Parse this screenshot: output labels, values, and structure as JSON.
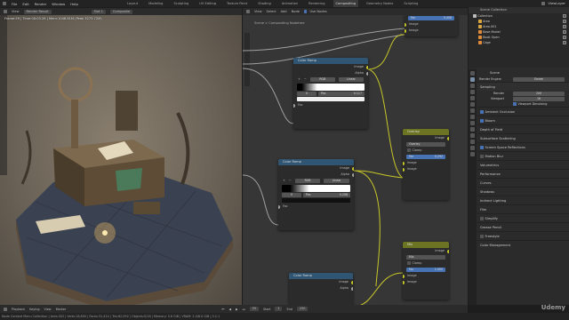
{
  "topbar": {
    "menus": [
      "File",
      "Edit",
      "Render",
      "Window",
      "Help"
    ],
    "workspaces": [
      "Layout",
      "Modeling",
      "Sculpting",
      "UV Editing",
      "Texture Paint",
      "Shading",
      "Animation",
      "Rendering",
      "Compositing",
      "Geometry Nodes",
      "Scripting"
    ],
    "active_workspace": "Compositing",
    "view_layer": "ViewLayer"
  },
  "viewport_header": {
    "items": [
      "View",
      "Render Result",
      "Slot 1",
      "Composite"
    ]
  },
  "viewport": {
    "info": "Frame:59 | Time:00:03.26 | Mem:1048.81M (Peak 3273.72M)"
  },
  "node_header": {
    "items": [
      "View",
      "Select",
      "Add",
      "Node",
      "Use Nodes"
    ],
    "blend_mode": "Multiply"
  },
  "node_breadcrumb": "Scene  >  Compositing Nodetree",
  "nodes": {
    "ramp1": {
      "title": "Color Ramp",
      "image": "Image",
      "alpha": "Alpha",
      "mode": "RGB",
      "interp": "Linear",
      "stop": "0",
      "pos_label": "Pos",
      "pos": "0.117",
      "fac": "Fac"
    },
    "ramp2": {
      "title": "Color Ramp",
      "image": "Image",
      "alpha": "Alpha",
      "mode": "RGB",
      "interp": "Linear",
      "stop": "0",
      "pos_label": "Pos",
      "pos": "0.208",
      "fac": "Fac"
    },
    "overlay": {
      "title": "Overlay",
      "image": "Image",
      "blend": "Overlay",
      "clamp": "Clamp",
      "fac_label": "Fac",
      "fac": "0.292",
      "in1": "Image",
      "in2": "Image"
    },
    "mix": {
      "title": "Mix",
      "image": "Image",
      "blend": "Mix",
      "clamp": "Clamp",
      "fac_label": "Fac",
      "fac": "1.000",
      "in1": "Image",
      "in2": "Image"
    },
    "top": {
      "fac_label": "Fac",
      "fac": "0.458",
      "in1": "Image",
      "in2": "Image"
    },
    "ramp3": {
      "title": "Color Ramp",
      "image": "Image",
      "alpha": "Alpha"
    }
  },
  "outliner": {
    "header": "Scene Collection",
    "items": [
      "Collection",
      "Area",
      "Area.001",
      "Base Model",
      "Book Open",
      "Cage"
    ]
  },
  "properties": {
    "title": "Scene",
    "render_engine_label": "Render Engine",
    "render_engine": "Eevee",
    "sampling": "Sampling",
    "render_label": "Render",
    "render": "200",
    "viewport_label": "Viewport",
    "viewport": "16",
    "viewport_denoising": "Viewport Denoising",
    "sections": [
      "Ambient Occlusion",
      "Bloom",
      "Depth of Field",
      "Subsurface Scattering",
      "Screen Space Reflections",
      "Motion Blur",
      "Volumetrics",
      "Performance",
      "Curves",
      "Shadows",
      "Indirect Lighting",
      "Film",
      "Simplify",
      "Grease Pencil",
      "Freestyle",
      "Color Management"
    ],
    "checked": [
      true,
      true,
      false,
      false,
      true,
      false,
      false,
      false,
      false,
      false,
      false,
      false,
      false,
      false,
      false,
      false
    ]
  },
  "timeline": {
    "items": [
      "Playback",
      "Keying",
      "View",
      "Marker"
    ],
    "frame": "59",
    "start_label": "Start",
    "start": "1",
    "end_label": "End",
    "end": "250"
  },
  "statusbar": "Node Context Menu      Collection | Area.002 | Verts:18,800 | Faces:31,414 | Tris:62,092 | Objects:0/18 | Memory: 3.6 GiB | VRAM: 2.5/8.0 GiB | 3.2.1",
  "watermark": "Udemy"
}
